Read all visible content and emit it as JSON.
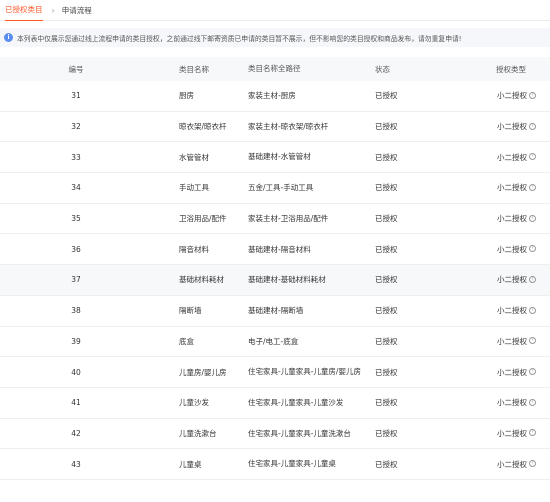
{
  "breadcrumb": {
    "active": "已授权类目",
    "separator": "›",
    "next": "申请流程"
  },
  "notice": {
    "icon": "info-icon",
    "text": "本列表中仅展示您通过线上流程申请的类目授权，之前通过线下邮寄资质已申请的类目暂不展示，但不影响您的类目授权和商品发布，请勿重复申请!"
  },
  "table": {
    "headers": [
      "编号",
      "类目名称",
      "类目名称全路径",
      "状态",
      "授权类型"
    ],
    "rows": [
      {
        "id": "31",
        "name": "厨房",
        "path": "家装主材-厨房",
        "status": "已授权",
        "type": "小二授权"
      },
      {
        "id": "32",
        "name": "晾衣架/晾衣杆",
        "path": "家装主材-晾衣架/晾衣杆",
        "status": "已授权",
        "type": "小二授权"
      },
      {
        "id": "33",
        "name": "水管管材",
        "path": "基础建材-水管管材",
        "status": "已授权",
        "type": "小二授权"
      },
      {
        "id": "34",
        "name": "手动工具",
        "path": "五金/工具-手动工具",
        "status": "已授权",
        "type": "小二授权"
      },
      {
        "id": "35",
        "name": "卫浴用品/配件",
        "path": "家装主材-卫浴用品/配件",
        "status": "已授权",
        "type": "小二授权"
      },
      {
        "id": "36",
        "name": "隔音材料",
        "path": "基础建材-隔音材料",
        "status": "已授权",
        "type": "小二授权"
      },
      {
        "id": "37",
        "name": "基础材料耗材",
        "path": "基础建材-基础材料耗材",
        "status": "已授权",
        "type": "小二授权"
      },
      {
        "id": "38",
        "name": "隔断墙",
        "path": "基础建材-隔断墙",
        "status": "已授权",
        "type": "小二授权"
      },
      {
        "id": "39",
        "name": "底盒",
        "path": "电子/电工-底盒",
        "status": "已授权",
        "type": "小二授权"
      },
      {
        "id": "40",
        "name": "儿童房/婴儿房",
        "path": "住宅家具-儿童家具-儿童房/婴儿房",
        "status": "已授权",
        "type": "小二授权"
      },
      {
        "id": "41",
        "name": "儿童沙发",
        "path": "住宅家具-儿童家具-儿童沙发",
        "status": "已授权",
        "type": "小二授权"
      },
      {
        "id": "42",
        "name": "儿童洗漱台",
        "path": "住宅家具-儿童家具-儿童洗漱台",
        "status": "已授权",
        "type": "小二授权"
      },
      {
        "id": "43",
        "name": "儿童桌",
        "path": "住宅家具-儿童家具-儿童桌",
        "status": "已授权",
        "type": "小二授权"
      }
    ],
    "help_icon": "question-circle-icon"
  },
  "colors": {
    "accent": "#ff5a2c",
    "info": "#5b8def",
    "header_bg": "#f7f8fa"
  }
}
